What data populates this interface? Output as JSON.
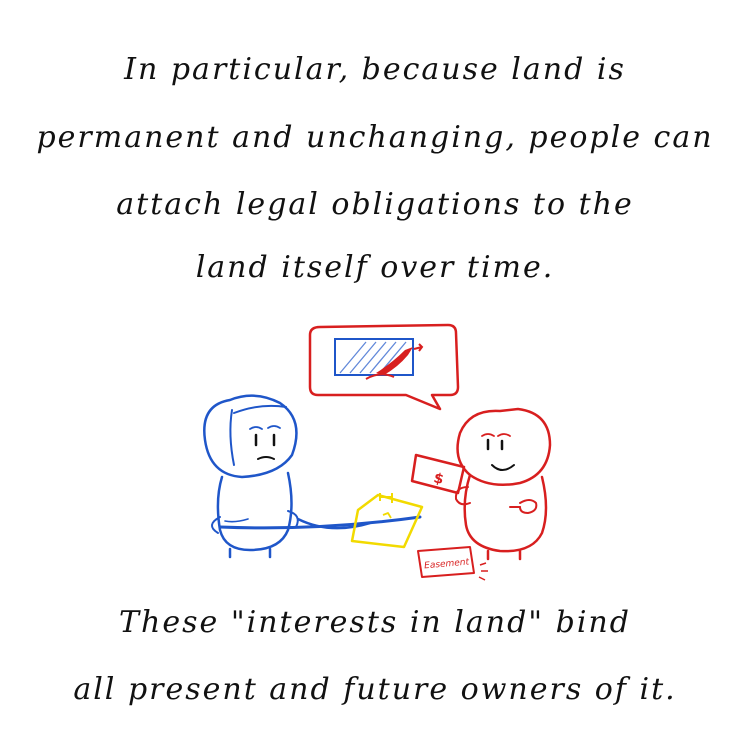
{
  "top_text": {
    "line1": "In particular, because land is",
    "line2": "permanent and unchanging, people can",
    "line3": "attach legal obligations to the",
    "line4": "land itself over time."
  },
  "bottom_text": {
    "line1": "These \"interests in land\" bind",
    "line2": "all present and future owners of it."
  },
  "illustration": {
    "money_symbol": "$",
    "document_label": "Easement",
    "colors": {
      "blue_character": "#1f56c9",
      "red_character": "#d81f1f",
      "document": "#f2da00",
      "ink": "#111111"
    }
  }
}
